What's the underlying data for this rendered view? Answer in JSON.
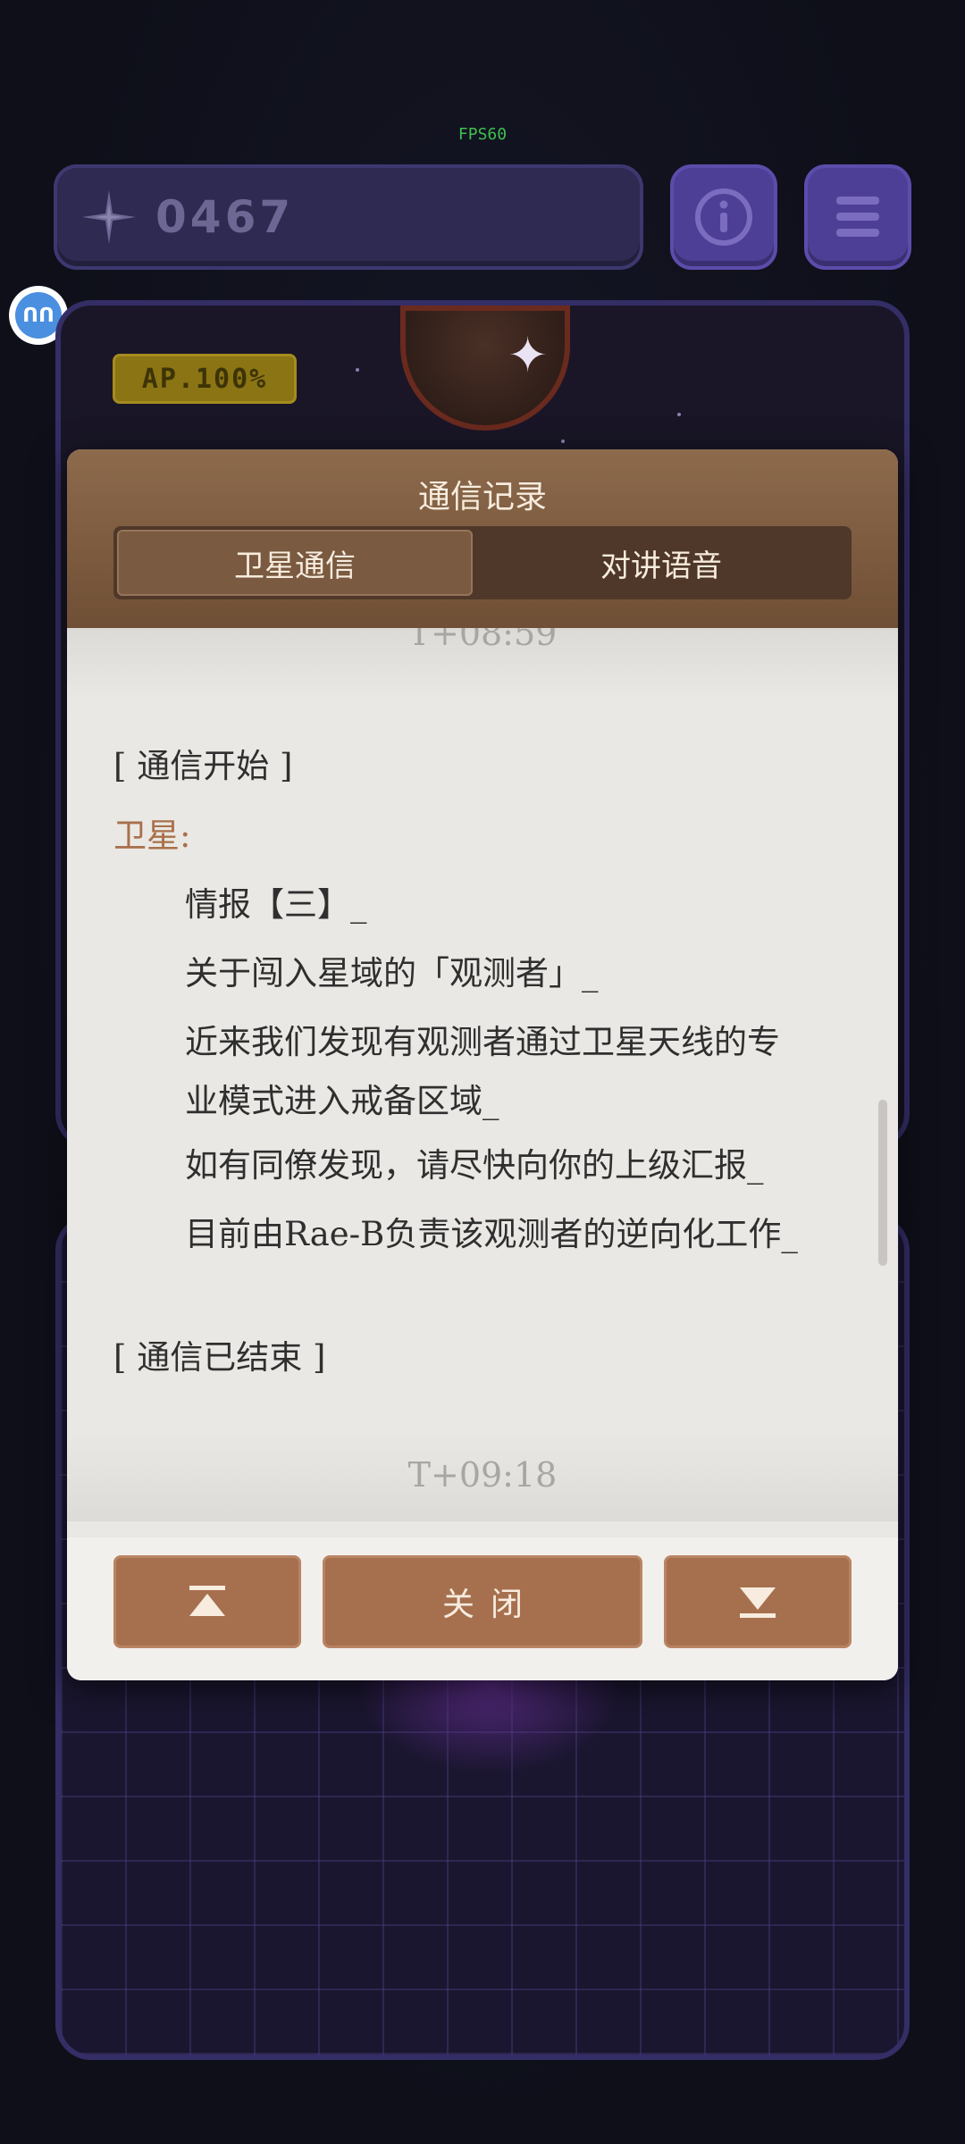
{
  "fps_label": "FPS60",
  "score": "0467",
  "avatar_label": "ᑎᑎ",
  "ap_badge": "AP.100%",
  "modal": {
    "title": "通信记录",
    "tabs": [
      {
        "label": "卫星通信",
        "active": true
      },
      {
        "label": "对讲语音",
        "active": false
      }
    ],
    "timestamp_top": "T+08:59",
    "timestamp_bottom": "T+09:18",
    "log": {
      "start": "[ 通信开始 ]",
      "sender": "卫星:",
      "messages": [
        "情报【三】_",
        "关于闯入星域的「观测者」_",
        "近来我们发现有观测者通过卫星天线的专业模式进入戒备区域_",
        "如有同僚发现，请尽快向你的上级汇报_",
        "目前由Rae-B负责该观测者的逆向化工作_"
      ],
      "end": "[ 通信已结束 ]"
    },
    "footer": {
      "scroll_top_icon": "scroll-to-top-icon",
      "close_label": "关闭",
      "scroll_bottom_icon": "scroll-to-bottom-icon"
    }
  },
  "colors": {
    "accent_brown": "#a6704f",
    "sender_color": "#a9704a",
    "panel_purple": "#4e3f96",
    "ap_yellow": "#8a7414"
  }
}
